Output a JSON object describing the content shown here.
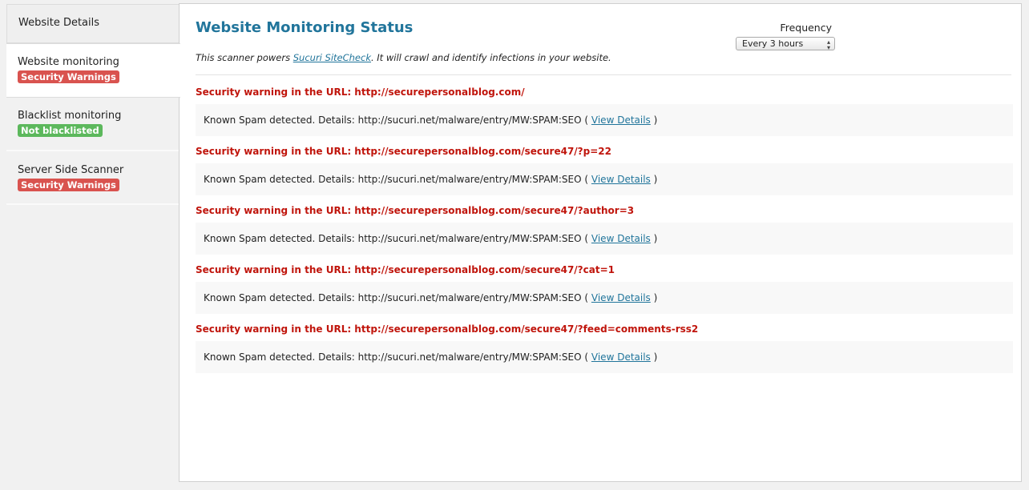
{
  "sidebar": {
    "tabs": [
      {
        "label": "Website Details"
      },
      {
        "label": "Website monitoring",
        "badge": "Security Warnings"
      },
      {
        "label": "Blacklist monitoring",
        "badge": "Not blacklisted"
      },
      {
        "label": "Server Side Scanner",
        "badge": "Security Warnings"
      }
    ]
  },
  "main": {
    "title": "Website Monitoring Status",
    "frequency_label": "Frequency",
    "frequency_value": "Every 3 hours",
    "desc_prefix": "This scanner powers ",
    "desc_link": "Sucuri SiteCheck",
    "desc_suffix": ". It will crawl and identify infections in your website.",
    "warnings": [
      {
        "title": "Security warning in the URL: http://securepersonalblog.com/",
        "detail": "Known Spam detected. Details: http://sucuri.net/malware/entry/MW:SPAM:SEO (",
        "link": "View Details",
        "close": ")"
      },
      {
        "title": "Security warning in the URL: http://securepersonalblog.com/secure47/?p=22",
        "detail": "Known Spam detected. Details: http://sucuri.net/malware/entry/MW:SPAM:SEO (",
        "link": "View Details",
        "close": ")"
      },
      {
        "title": "Security warning in the URL: http://securepersonalblog.com/secure47/?author=3",
        "detail": "Known Spam detected. Details: http://sucuri.net/malware/entry/MW:SPAM:SEO (",
        "link": "View Details",
        "close": ")"
      },
      {
        "title": "Security warning in the URL: http://securepersonalblog.com/secure47/?cat=1",
        "detail": "Known Spam detected. Details: http://sucuri.net/malware/entry/MW:SPAM:SEO (",
        "link": "View Details",
        "close": ")"
      },
      {
        "title": "Security warning in the URL: http://securepersonalblog.com/secure47/?feed=comments-rss2",
        "detail": "Known Spam detected. Details: http://sucuri.net/malware/entry/MW:SPAM:SEO (",
        "link": "View Details",
        "close": ")"
      }
    ]
  },
  "colors": {
    "accent": "#21759b",
    "warning_red": "#c0150c",
    "badge_red": "#d9534f",
    "badge_green": "#5cb85c"
  }
}
